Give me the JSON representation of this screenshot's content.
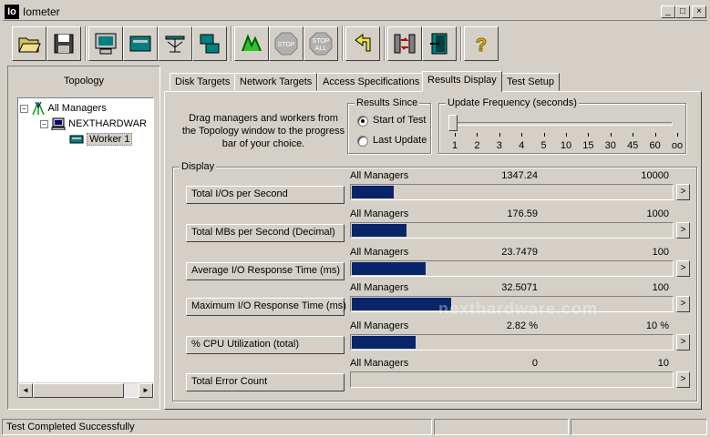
{
  "window": {
    "app_icon": "Io",
    "title": "Iometer",
    "minimize": "_",
    "maximize": "□",
    "close": "×"
  },
  "toolbar": {
    "buttons": [
      "open-icon",
      "save-icon",
      "new-disk-worker-icon",
      "new-network-worker-icon",
      "duplicate-worker-icon",
      "disconnect-icon",
      "start-icon",
      "stop-icon",
      "stop-all-icon",
      "reset-workers-icon",
      "exit-icon",
      "about-icon"
    ],
    "stop_label": "STOP",
    "stop_all_label": "STOP",
    "stop_all_sub": "ALL",
    "help_label": "?"
  },
  "topology": {
    "title": "Topology",
    "items": [
      {
        "label": "All Managers",
        "expander": "−"
      },
      {
        "label": "NEXTHARDWAR",
        "expander": "−"
      },
      {
        "label": "Worker 1"
      }
    ],
    "scroll_left": "◄",
    "scroll_right": "►"
  },
  "tabs": [
    "Disk Targets",
    "Network Targets",
    "Access Specifications",
    "Results Display",
    "Test Setup"
  ],
  "active_tab": "Results Display",
  "drag_instructions": "Drag managers and workers from the Topology window to the progress bar of your choice.",
  "results_since": {
    "title": "Results Since",
    "options": [
      "Start of Test",
      "Last Update"
    ],
    "selected": "Start of Test"
  },
  "update_frequency": {
    "title": "Update Frequency (seconds)",
    "ticks": [
      "1",
      "2",
      "3",
      "4",
      "5",
      "10",
      "15",
      "30",
      "45",
      "60",
      "oo"
    ],
    "selected": "1"
  },
  "display": {
    "title": "Display",
    "metrics": [
      {
        "label": "Total I/Os per Second",
        "source": "All Managers",
        "value": "1347.24",
        "max": "10000",
        "fill_fraction": 0.13,
        "arrow": ">"
      },
      {
        "label": "Total MBs per Second (Decimal)",
        "source": "All Managers",
        "value": "176.59",
        "max": "1000",
        "fill_fraction": 0.17,
        "arrow": ">"
      },
      {
        "label": "Average I/O Response Time (ms)",
        "source": "All Managers",
        "value": "23.7479",
        "max": "100",
        "fill_fraction": 0.23,
        "arrow": ">"
      },
      {
        "label": "Maximum I/O Response Time (ms)",
        "source": "All Managers",
        "value": "32.5071",
        "max": "100",
        "fill_fraction": 0.31,
        "arrow": ">"
      },
      {
        "label": "% CPU Utilization (total)",
        "source": "All Managers",
        "value": "2.82 %",
        "max": "10 %",
        "fill_fraction": 0.2,
        "arrow": ">"
      },
      {
        "label": "Total Error Count",
        "source": "All Managers",
        "value": "0",
        "max": "10",
        "fill_fraction": 0,
        "arrow": ">"
      }
    ]
  },
  "watermark": "nexthardware.com",
  "status": {
    "message": "Test Completed Successfully"
  },
  "colors": {
    "bar_fill": "#0a246a",
    "window_bg": "#d4d0c8"
  }
}
